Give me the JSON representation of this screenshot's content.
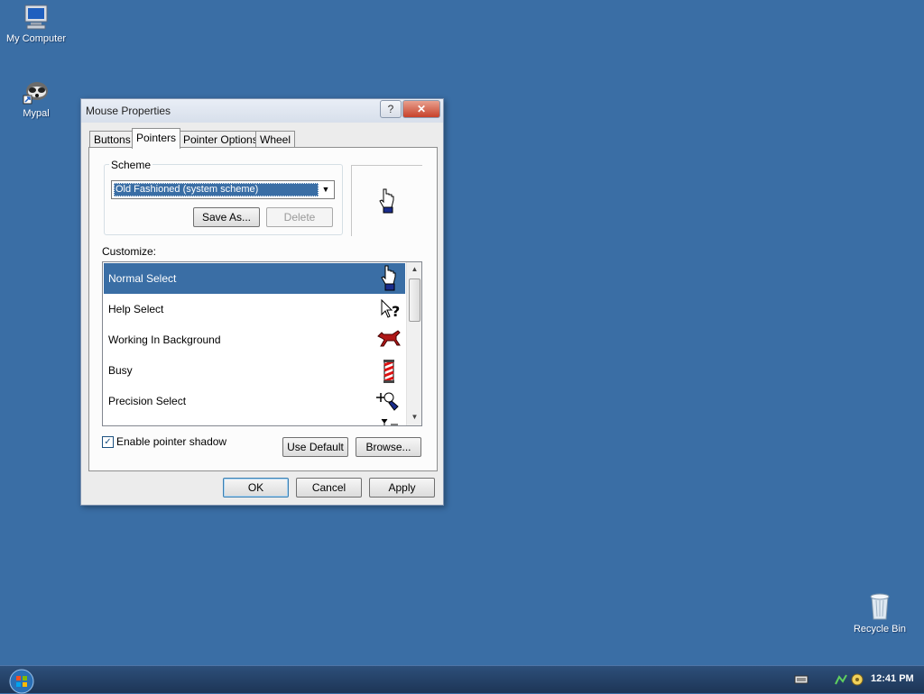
{
  "desktop": {
    "icons": [
      {
        "label": "My Computer"
      },
      {
        "label": "Mypal"
      },
      {
        "label": "Recycle Bin"
      }
    ]
  },
  "window": {
    "title": "Mouse Properties",
    "help_button": "?",
    "close_button": "✕",
    "tabs": [
      {
        "label": "Buttons"
      },
      {
        "label": "Pointers"
      },
      {
        "label": "Pointer Options"
      },
      {
        "label": "Wheel"
      }
    ],
    "scheme": {
      "legend": "Scheme",
      "selected": "Old Fashioned (system scheme)",
      "save_as": "Save As...",
      "delete": "Delete"
    },
    "customize": {
      "label": "Customize:",
      "items": [
        {
          "label": "Normal Select",
          "icon": "hand-pointer-icon"
        },
        {
          "label": "Help Select",
          "icon": "help-pointer-icon"
        },
        {
          "label": "Working In Background",
          "icon": "horse-busy-icon"
        },
        {
          "label": "Busy",
          "icon": "barber-pole-icon"
        },
        {
          "label": "Precision Select",
          "icon": "precision-pointer-icon"
        }
      ]
    },
    "enable_shadow": {
      "label": "Enable pointer shadow",
      "checked": true
    },
    "use_default": "Use Default",
    "browse": "Browse...",
    "ok": "OK",
    "cancel": "Cancel",
    "apply": "Apply"
  },
  "taskbar": {
    "clock": "12:41 PM"
  },
  "colors": {
    "desktop": "#3a6ea5",
    "selection": "#3a6ea5",
    "taskbar": "#1d3556"
  }
}
